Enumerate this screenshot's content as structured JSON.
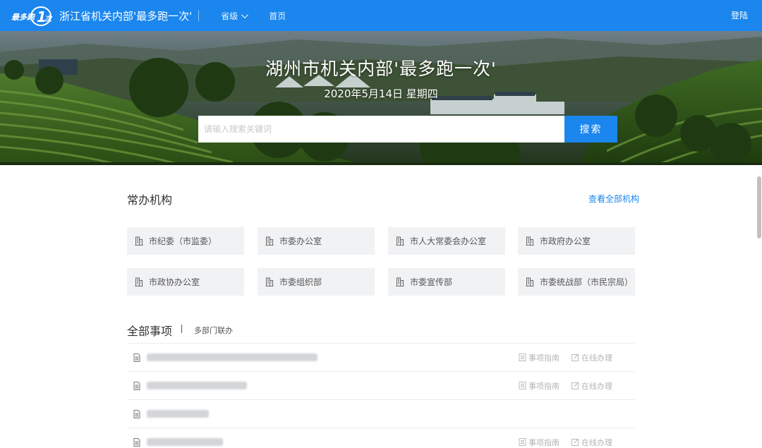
{
  "header": {
    "logo_text": "最多跑1次",
    "site_title": "浙江省机关内部'最多跑一次'",
    "nav_level": "省级",
    "nav_home": "首页",
    "login": "登陆"
  },
  "hero": {
    "title": "湖州市机关内部'最多跑一次'",
    "date": "2020年5月14日 星期四",
    "search_placeholder": "请输入搜索关键词",
    "search_button": "搜索"
  },
  "orgs": {
    "title": "常办机构",
    "view_all": "查看全部机构",
    "items": [
      {
        "label": "市纪委（市监委）"
      },
      {
        "label": "市委办公室"
      },
      {
        "label": "市人大常委会办公室"
      },
      {
        "label": "市政府办公室"
      },
      {
        "label": "市政协办公室"
      },
      {
        "label": "市委组织部"
      },
      {
        "label": "市委宣传部"
      },
      {
        "label": "市委统战部（市民宗局）"
      }
    ]
  },
  "matters": {
    "title": "全部事项",
    "tab_multi": "多部门联办",
    "guide_label": "事项指南",
    "online_label": "在线办理"
  },
  "colors": {
    "primary": "#1a86ee",
    "card_bg": "#f1f2f4",
    "muted_text": "#b5b5b5"
  }
}
